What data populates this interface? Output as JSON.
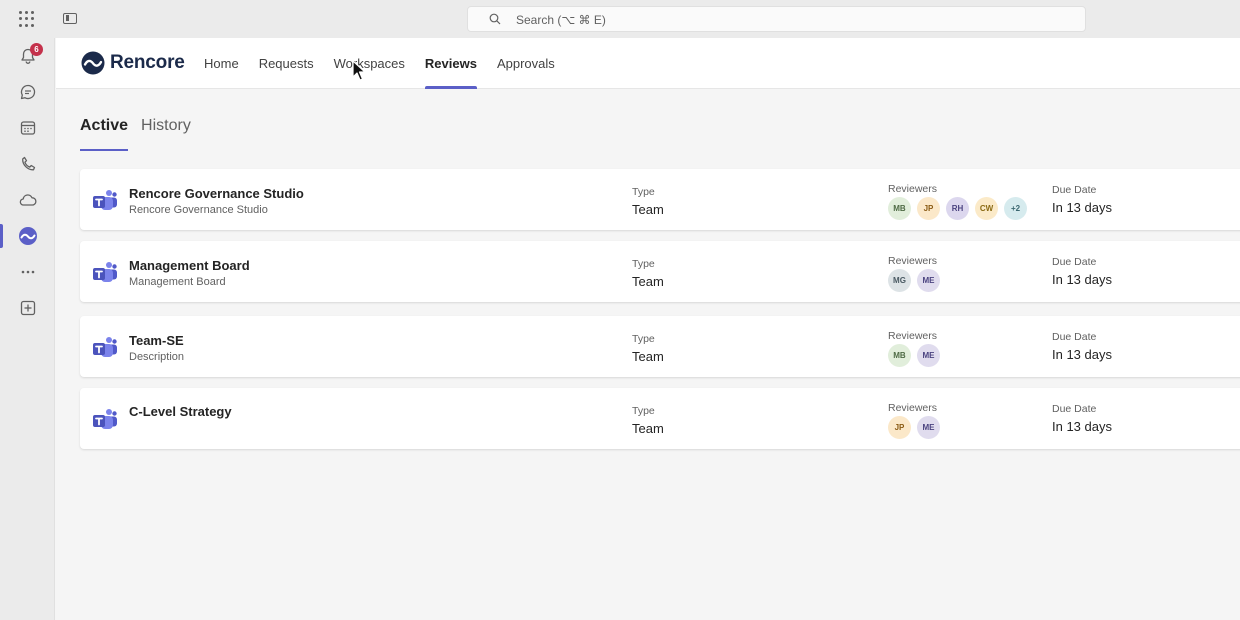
{
  "topbar": {
    "search_placeholder": "Search (⌥ ⌘ E)"
  },
  "rail": {
    "notification_count": "6",
    "items": [
      "activity-icon",
      "chat-icon",
      "calendar-icon",
      "calls-icon",
      "onedrive-icon",
      "rencore-app-icon",
      "more-icon",
      "add-app-icon"
    ]
  },
  "app": {
    "brand": "Rencore",
    "nav": [
      "Home",
      "Requests",
      "Workspaces",
      "Reviews",
      "Approvals"
    ],
    "nav_active": "Reviews"
  },
  "subtabs": [
    "Active",
    "History"
  ],
  "subtab_active": "Active",
  "colors": {
    "accent": "#5b5fc7",
    "badge": "#c4314b",
    "brand_dark": "#1b2a4a"
  },
  "reviews": [
    {
      "title": "Rencore Governance Studio",
      "subtitle": "Rencore Governance Studio",
      "type_label": "Type",
      "type": "Team",
      "reviewers_label": "Reviewers",
      "reviewers": [
        {
          "initials": "MB",
          "bg": "#e1eedb",
          "fg": "#4f6b45"
        },
        {
          "initials": "JP",
          "bg": "#fbe8c9",
          "fg": "#8a5a13"
        },
        {
          "initials": "RH",
          "bg": "#dcd7ee",
          "fg": "#4b4380"
        },
        {
          "initials": "CW",
          "bg": "#fbeac8",
          "fg": "#8a6a13"
        },
        {
          "initials": "+2",
          "bg": "#d6ebee",
          "fg": "#3b6770"
        }
      ],
      "due_label": "Due Date",
      "due": "In 13 days"
    },
    {
      "title": "Management Board",
      "subtitle": "Management Board",
      "type_label": "Type",
      "type": "Team",
      "reviewers_label": "Reviewers",
      "reviewers": [
        {
          "initials": "MG",
          "bg": "#dde3e6",
          "fg": "#4a5a63"
        },
        {
          "initials": "ME",
          "bg": "#e0dcee",
          "fg": "#4b4380"
        }
      ],
      "due_label": "Due Date",
      "due": "In 13 days"
    },
    {
      "title": "Team-SE",
      "subtitle": "Description",
      "type_label": "Type",
      "type": "Team",
      "reviewers_label": "Reviewers",
      "reviewers": [
        {
          "initials": "MB",
          "bg": "#e1eedb",
          "fg": "#4f6b45"
        },
        {
          "initials": "ME",
          "bg": "#e0dcee",
          "fg": "#4b4380"
        }
      ],
      "due_label": "Due Date",
      "due": "In 13 days"
    },
    {
      "title": "C-Level Strategy",
      "subtitle": "",
      "type_label": "Type",
      "type": "Team",
      "reviewers_label": "Reviewers",
      "reviewers": [
        {
          "initials": "JP",
          "bg": "#fbe8c9",
          "fg": "#8a5a13"
        },
        {
          "initials": "ME",
          "bg": "#e0dcee",
          "fg": "#4b4380"
        }
      ],
      "due_label": "Due Date",
      "due": "In 13 days"
    }
  ]
}
